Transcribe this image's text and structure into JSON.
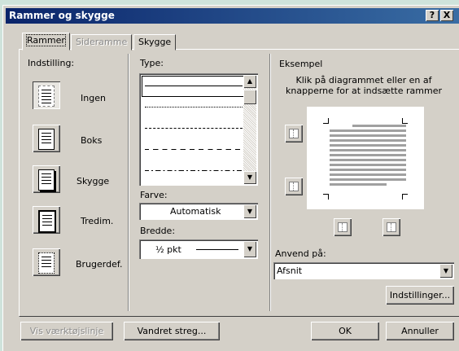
{
  "window": {
    "title": "Rammer og skygge",
    "help_btn": "?",
    "close_btn": "X"
  },
  "tabs": [
    {
      "label": "Rammer",
      "active": true
    },
    {
      "label": "Sideramme",
      "disabled": true
    },
    {
      "label": "Skygge"
    }
  ],
  "settings": {
    "heading": "Indstilling:",
    "items": [
      {
        "label": "Ingen"
      },
      {
        "label": "Boks"
      },
      {
        "label": "Skygge"
      },
      {
        "label": "Tredim."
      },
      {
        "label": "Brugerdef."
      }
    ]
  },
  "style": {
    "type_label": "Type:",
    "color_label": "Farve:",
    "color_value": "Automatisk",
    "width_label": "Bredde:",
    "width_value": "½ pkt"
  },
  "preview": {
    "heading": "Eksempel",
    "hint": "Klik på diagrammet eller en af knapperne for at indsætte rammer",
    "apply_label": "Anvend på:",
    "apply_value": "Afsnit",
    "options_button": "Indstillinger..."
  },
  "footer": {
    "toolbar_button": "Vis værktøjslinje",
    "hline_button": "Vandret streg...",
    "ok_button": "OK",
    "cancel_button": "Annuller"
  }
}
